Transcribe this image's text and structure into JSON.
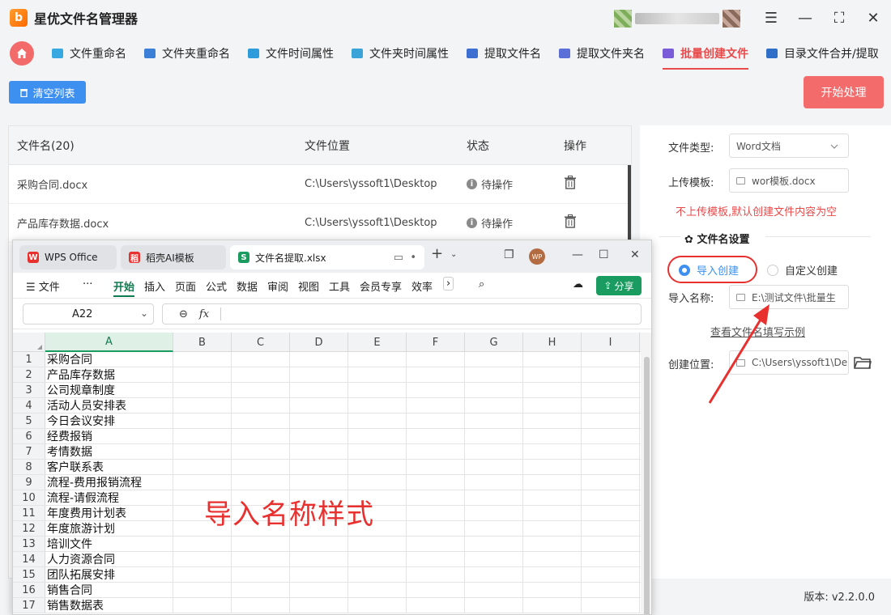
{
  "app": {
    "logo": "b",
    "title": "星优文件名管理器"
  },
  "window_controls": {
    "settings": "☰",
    "minimize": "—",
    "maximize": "⛶",
    "close": "✕"
  },
  "nav": {
    "tabs": [
      {
        "label": "文件重命名",
        "icon_color": "#35a9e0"
      },
      {
        "label": "文件夹重命名",
        "icon_color": "#3c7fd6"
      },
      {
        "label": "文件时间属性",
        "icon_color": "#2e9cdb"
      },
      {
        "label": "文件夹时间属性",
        "icon_color": "#3aa3d8"
      },
      {
        "label": "提取文件名",
        "icon_color": "#3d6fd0"
      },
      {
        "label": "提取文件夹名",
        "icon_color": "#5a6fd8"
      },
      {
        "label": "批量创建文件",
        "icon_color": "#7a5bd8"
      },
      {
        "label": "目录文件合并/提取",
        "icon_color": "#2f6fc8"
      }
    ],
    "active_index": 6
  },
  "toolbar": {
    "clear_label": "清空列表",
    "start_label": "开始处理"
  },
  "file_table": {
    "headers": {
      "name": "文件名(20)",
      "location": "文件位置",
      "status": "状态",
      "action": "操作"
    },
    "rows": [
      {
        "name": "采购合同.docx",
        "location": "C:\\Users\\yssoft1\\Desktop",
        "status": "待操作"
      },
      {
        "name": "产品库存数据.docx",
        "location": "C:\\Users\\yssoft1\\Desktop",
        "status": "待操作"
      }
    ]
  },
  "settings": {
    "file_type_label": "文件类型:",
    "file_type_value": "Word文档",
    "template_label": "上传模板:",
    "template_value": "wor模板.docx",
    "hint": "不上传模板,默认创建文件内容为空",
    "section_title": "文件名设置",
    "radio_import": "导入创建",
    "radio_custom": "自定义创建",
    "import_name_label": "导入名称:",
    "import_name_value": "E:\\测试文件\\批量生",
    "example_link": "查看文件名填写示例",
    "create_location_label": "创建位置:",
    "create_location_value": "C:\\Users\\yssoft1\\De"
  },
  "footer": {
    "version": "版本: v2.2.0.0"
  },
  "wps": {
    "tabs": [
      {
        "label": "WPS Office",
        "logo": "W",
        "logo_color": "#e8302f"
      },
      {
        "label": "稻壳AI模板",
        "logo": "稻",
        "logo_color": "#e8302f"
      },
      {
        "label": "文件名提取.xlsx",
        "logo": "S",
        "logo_color": "#1a9b5f"
      }
    ],
    "avatar": "WP",
    "menu": [
      "文件",
      "开始",
      "插入",
      "页面",
      "公式",
      "数据",
      "审阅",
      "视图",
      "工具",
      "会员专享",
      "效率"
    ],
    "menu_active": "开始",
    "share_label": "分享",
    "name_box": "A22",
    "fx_label": "fx",
    "columns": [
      "A",
      "B",
      "C",
      "D",
      "E",
      "F",
      "G",
      "H",
      "I"
    ],
    "rows": [
      {
        "num": "1",
        "a": "采购合同"
      },
      {
        "num": "2",
        "a": "产品库存数据"
      },
      {
        "num": "3",
        "a": "公司规章制度"
      },
      {
        "num": "4",
        "a": "活动人员安排表"
      },
      {
        "num": "5",
        "a": "今日会议安排"
      },
      {
        "num": "6",
        "a": "经费报销"
      },
      {
        "num": "7",
        "a": "考情数据"
      },
      {
        "num": "8",
        "a": "客户联系表"
      },
      {
        "num": "9",
        "a": "流程-费用报销流程"
      },
      {
        "num": "10",
        "a": "流程-请假流程"
      },
      {
        "num": "11",
        "a": "年度费用计划表"
      },
      {
        "num": "12",
        "a": "年度旅游计划"
      },
      {
        "num": "13",
        "a": "培训文件"
      },
      {
        "num": "14",
        "a": "人力资源合同"
      },
      {
        "num": "15",
        "a": "团队拓展安排"
      },
      {
        "num": "16",
        "a": "销售合同"
      },
      {
        "num": "17",
        "a": "销售数据表"
      }
    ]
  },
  "annotation": {
    "caption": "导入名称样式",
    "color": "#e8302f"
  }
}
